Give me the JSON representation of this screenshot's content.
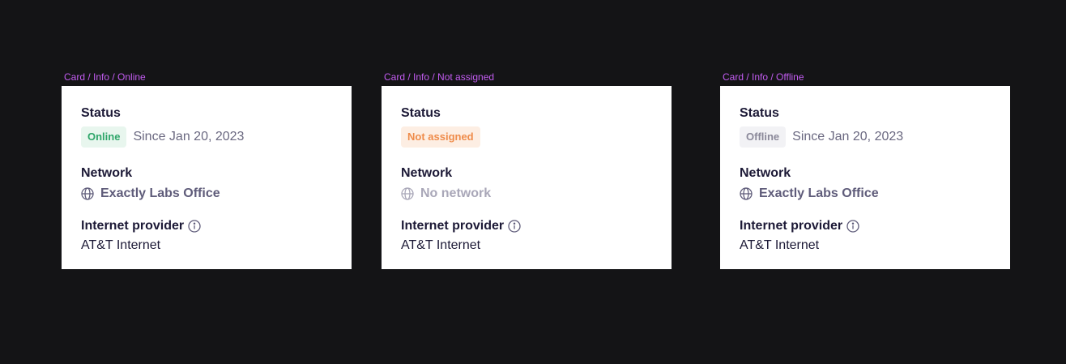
{
  "cards": [
    {
      "frame_label": "Card / Info / Online",
      "status_title": "Status",
      "badge": "Online",
      "badge_variant": "online",
      "since": "Since Jan 20, 2023",
      "network_title": "Network",
      "network_icon": "globe-icon",
      "network_value": "Exactly Labs Office",
      "provider_title": "Internet provider",
      "provider_icon": "info-icon",
      "provider_value": "AT&T Internet"
    },
    {
      "frame_label": "Card / Info / Not assigned",
      "status_title": "Status",
      "badge": "Not assigned",
      "badge_variant": "notassigned",
      "since": "",
      "network_title": "Network",
      "network_icon": "globe-icon",
      "network_value": "No network",
      "provider_title": "Internet provider",
      "provider_icon": "info-icon",
      "provider_value": "AT&T Internet"
    },
    {
      "frame_label": "Card / Info / Offline",
      "status_title": "Status",
      "badge": "Offline",
      "badge_variant": "offline",
      "since": "Since Jan 20, 2023",
      "network_title": "Network",
      "network_icon": "globe-icon",
      "network_value": "Exactly Labs Office",
      "provider_title": "Internet provider",
      "provider_icon": "info-icon",
      "provider_value": "AT&T Internet"
    }
  ],
  "colors": {
    "canvas": "#141416",
    "frame_label": "#c25cf0",
    "online": "#2ea66a",
    "not_assigned": "#ef8c4b",
    "offline": "#8a8899",
    "heading": "#1c1936"
  }
}
